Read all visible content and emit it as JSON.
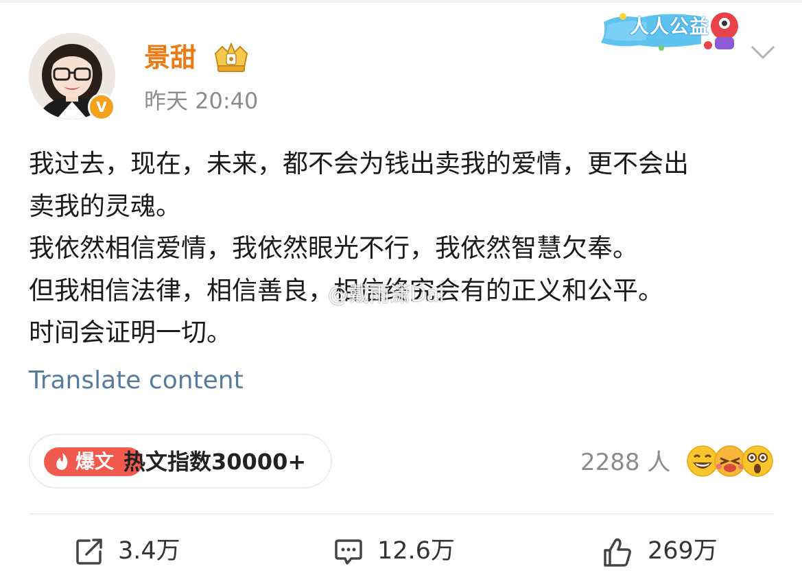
{
  "post": {
    "username": "景甜",
    "timestamp": "昨天 20:40",
    "verified_badge": "V",
    "banner_label": "人人公益",
    "content_lines": [
      "我过去，现在，未来，都不会为钱出卖我的爱情，更不会出",
      "卖我的灵魂。",
      "我依然相信爱情，我依然眼光不行，我依然智慧欠奉。",
      "但我相信法律，相信善良，相信终究会有的正义和公平。",
      "时间会证明一切。"
    ],
    "watermark": "@戴雨潇Dai",
    "translate_label": "Translate content"
  },
  "hot": {
    "tag_label": "爆文",
    "index_text": "热文指数30000+"
  },
  "reactions": {
    "count_text": "2288 人",
    "emojis": [
      "grinning-emoji",
      "laughing-tears-emoji",
      "surprised-emoji"
    ]
  },
  "actions": {
    "repost": "3.4万",
    "comment": "12.6万",
    "like": "269万"
  },
  "colors": {
    "username": "#ed7a14",
    "link": "#577b9c",
    "hot_tag": "#f15a4f",
    "verified": "#f4a21e"
  }
}
